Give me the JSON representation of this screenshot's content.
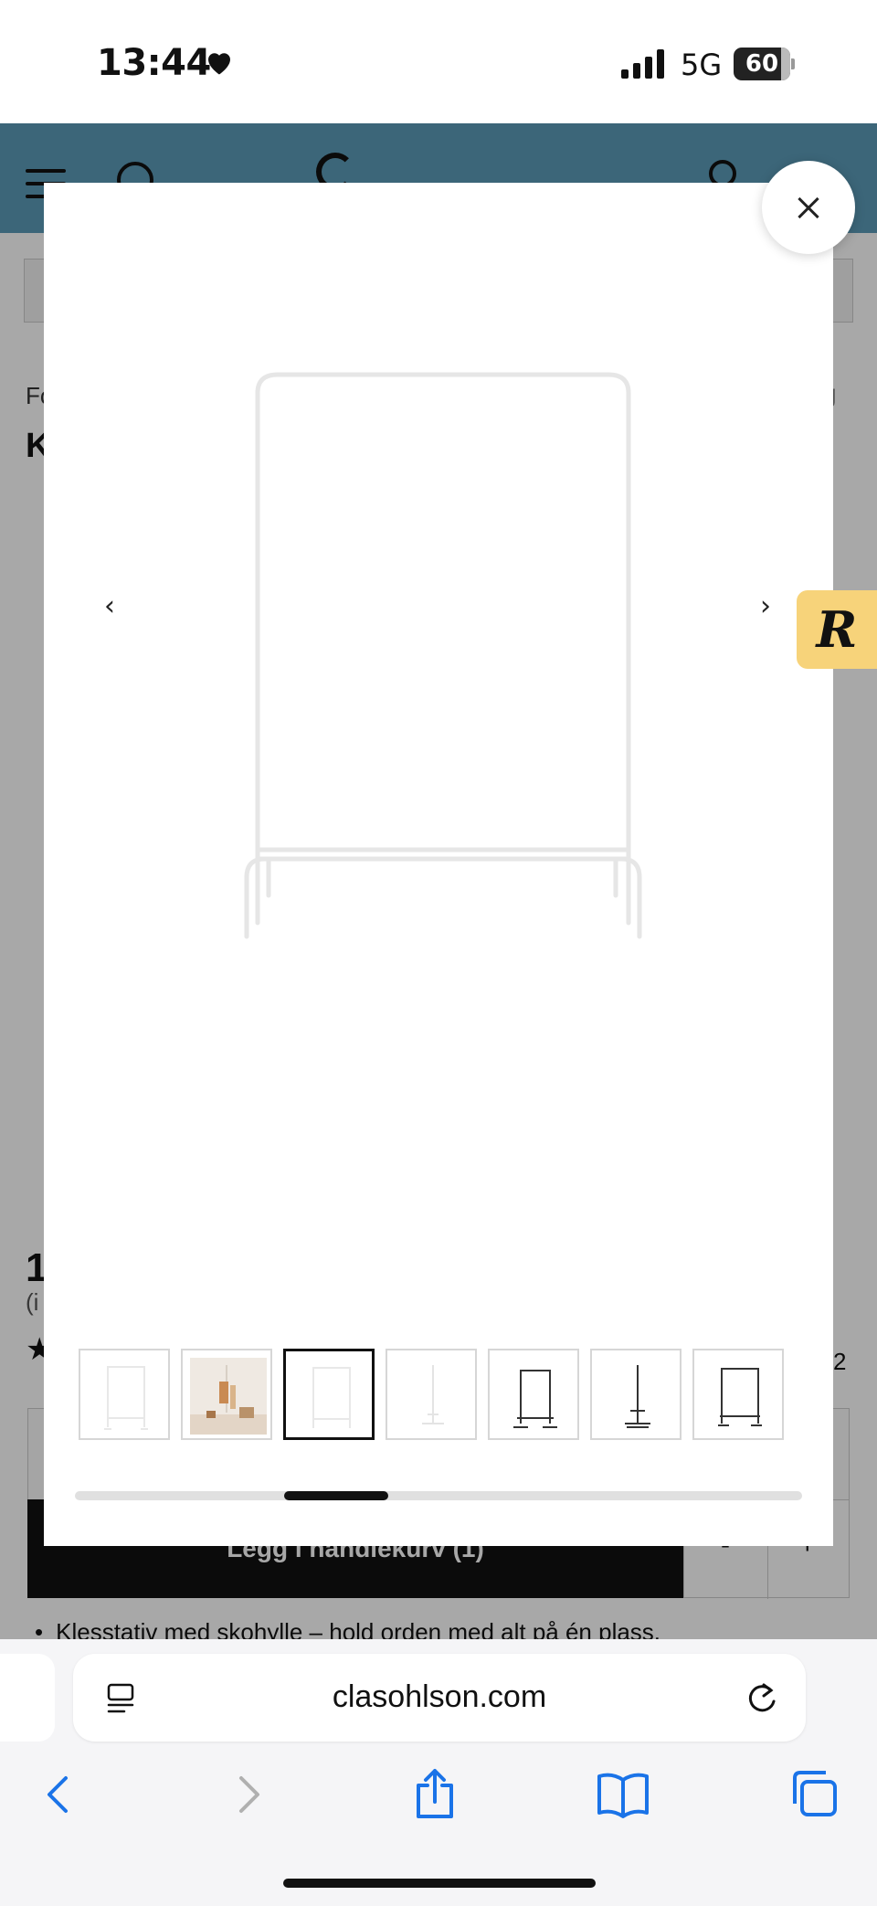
{
  "status_bar": {
    "time": "13:44",
    "network": "5G",
    "battery": "60"
  },
  "background_page": {
    "breadcrumb_start": "Fo",
    "breadcrumb_end": "g",
    "title_start": "K",
    "price_start": "1",
    "price_note_start": "(i",
    "review_count_end": "2",
    "add_to_cart_label": "Legg i handlekurv (1)",
    "qty_minus": "-",
    "qty_plus": "+",
    "bullet_text": "Klesstativ med skohylle – hold orden med alt på én plass."
  },
  "gallery": {
    "prev_arrow": "‹",
    "next_arrow": "›",
    "active_thumb_index": 2,
    "thumbnail_count": 7,
    "scroll_position": 0.33
  },
  "side_badge": {
    "letter": "R"
  },
  "browser": {
    "url": "clasohlson.com"
  }
}
